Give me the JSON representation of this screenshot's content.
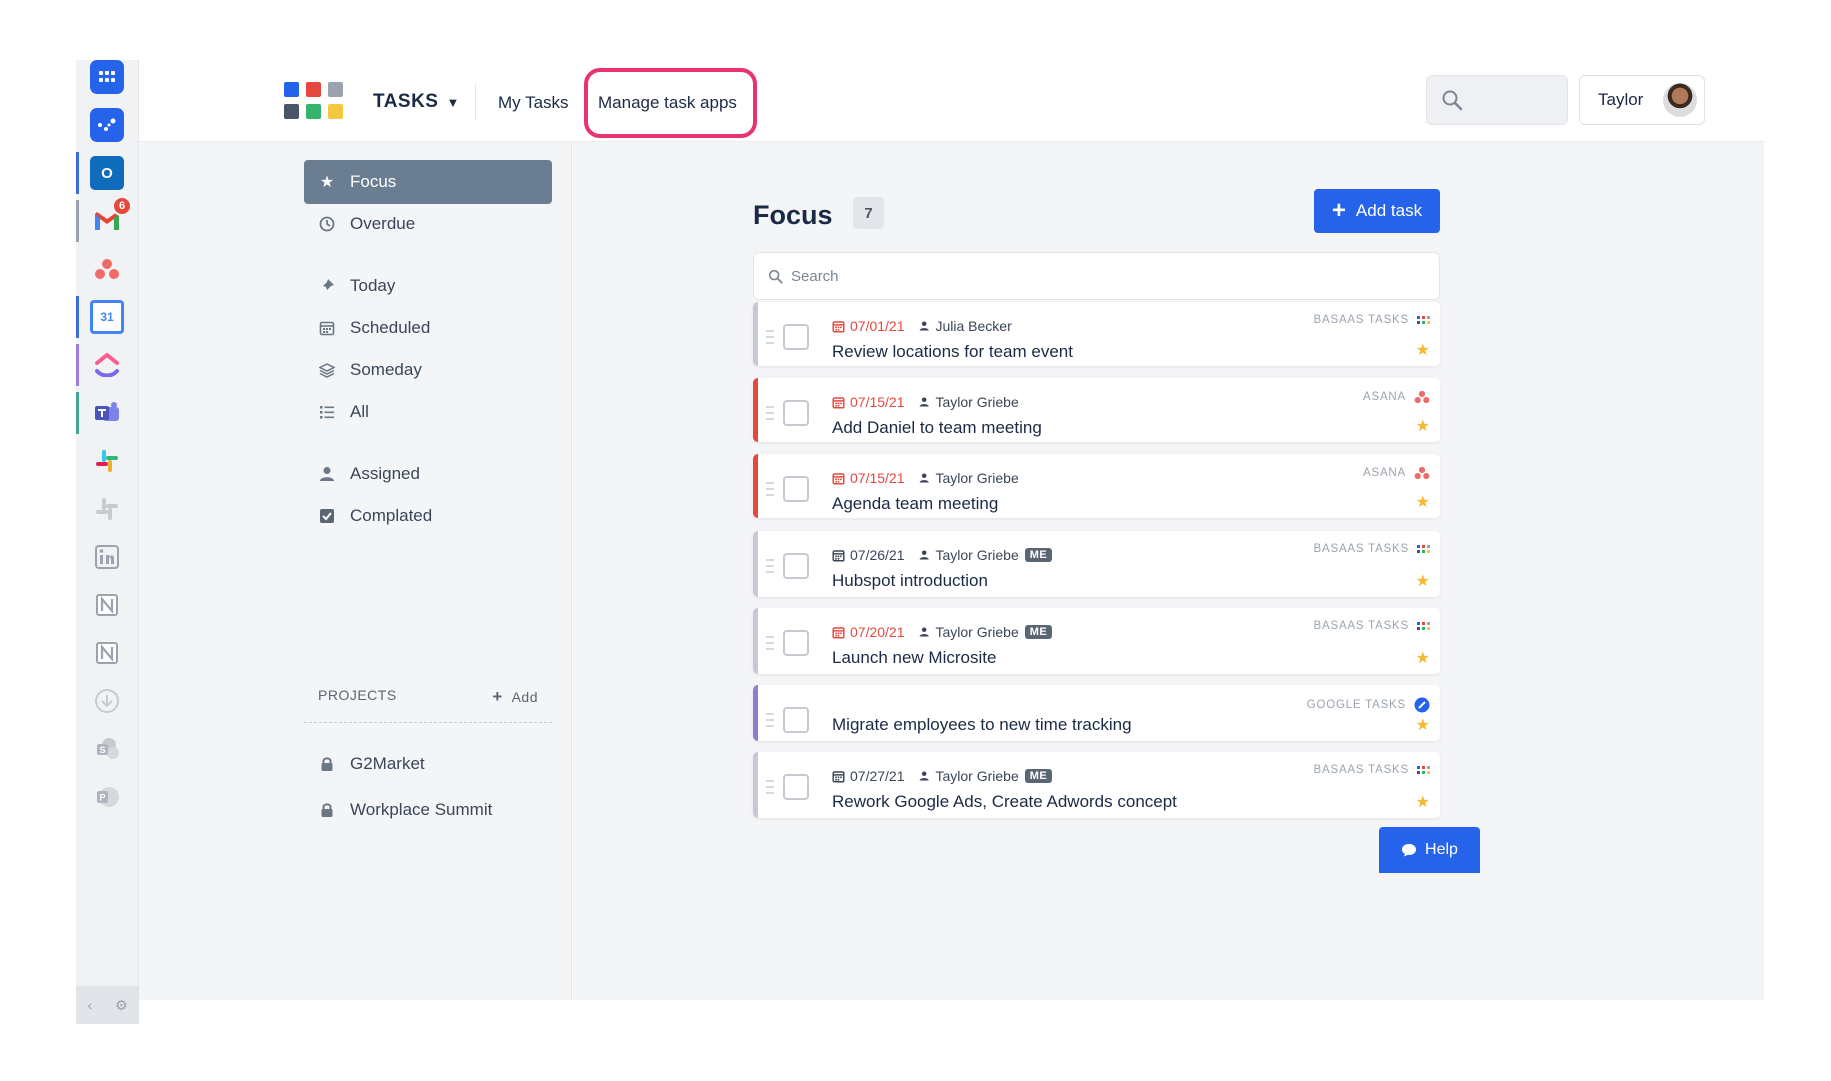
{
  "header": {
    "brand": "TASKS",
    "caret": "▼",
    "links": {
      "my_tasks": "My Tasks",
      "manage_apps": "Manage task apps"
    },
    "user_name": "Taylor"
  },
  "rail": {
    "apps": [
      "basaas-apps",
      "basaas-tasks",
      "outlook",
      "gmail",
      "asana",
      "google-calendar",
      "clickup",
      "teams",
      "slack",
      "slack-muted",
      "linkedin",
      "notion",
      "notion-alt",
      "download",
      "sharepoint",
      "powerpoint"
    ],
    "gmail_badge": "6",
    "calendar_day": "31"
  },
  "nav": {
    "items": [
      {
        "label": "Focus",
        "icon": "star-icon",
        "active": true
      },
      {
        "label": "Overdue",
        "icon": "clock-icon"
      },
      {
        "label": "Today",
        "icon": "pin-icon"
      },
      {
        "label": "Scheduled",
        "icon": "calendar-icon"
      },
      {
        "label": "Someday",
        "icon": "layers-icon"
      },
      {
        "label": "All",
        "icon": "list-icon"
      },
      {
        "label": "Assigned",
        "icon": "user-icon"
      },
      {
        "label": "Complated",
        "icon": "checkbox-icon"
      }
    ],
    "projects_label": "PROJECTS",
    "projects_add": "Add",
    "projects": [
      "G2Market",
      "Workplace Summit"
    ]
  },
  "main": {
    "title": "Focus",
    "count": "7",
    "add_label": "Add task",
    "search_placeholder": "Search",
    "tasks": [
      {
        "date": "07/01/21",
        "late": true,
        "person": "Julia Becker",
        "me": false,
        "name": "Review locations for team event",
        "source": "BASAAS TASKS",
        "bar": "#c5cad1"
      },
      {
        "date": "07/15/21",
        "late": true,
        "person": "Taylor Griebe",
        "me": false,
        "name": "Add Daniel to team meeting",
        "source": "ASANA",
        "bar": "#e5483d"
      },
      {
        "date": "07/15/21",
        "late": true,
        "person": "Taylor Griebe",
        "me": false,
        "name": "Agenda team meeting",
        "source": "ASANA",
        "bar": "#e5483d"
      },
      {
        "date": "07/26/21",
        "late": false,
        "person": "Taylor Griebe",
        "me": true,
        "name": "Hubspot introduction",
        "source": "BASAAS TASKS",
        "bar": "#c5cad1"
      },
      {
        "date": "07/20/21",
        "late": true,
        "person": "Taylor Griebe",
        "me": true,
        "name": "Launch new Microsite",
        "source": "BASAAS TASKS",
        "bar": "#c5cad1"
      },
      {
        "date": "",
        "late": false,
        "person": "",
        "me": false,
        "name": "Migrate employees to new time tracking",
        "source": "GOOGLE TASKS",
        "bar": "#8b7fd1"
      },
      {
        "date": "07/27/21",
        "late": false,
        "person": "Taylor Griebe",
        "me": true,
        "name": "Rework Google Ads, Create Adwords concept",
        "source": "BASAAS TASKS",
        "bar": "#c5cad1"
      }
    ],
    "me_tag": "ME"
  },
  "help_label": "Help",
  "colors": {
    "accent": "#2563eb",
    "highlight": "#e8336e",
    "late": "#e5483d",
    "star": "#f5b82e"
  }
}
